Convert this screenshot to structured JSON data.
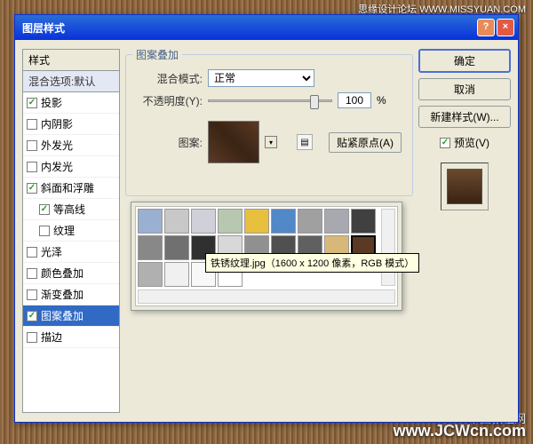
{
  "top_watermark": "思缘设计论坛  WWW.MISSYUAN.COM",
  "bottom_cn": "中国教程网",
  "bottom_url": "www.JCWcn.com",
  "dialog": {
    "title": "图层样式",
    "styles_header": "样式",
    "blend_defaults": "混合选项:默认",
    "items": [
      {
        "label": "投影",
        "checked": true,
        "indent": false
      },
      {
        "label": "内阴影",
        "checked": false,
        "indent": false
      },
      {
        "label": "外发光",
        "checked": false,
        "indent": false
      },
      {
        "label": "内发光",
        "checked": false,
        "indent": false
      },
      {
        "label": "斜面和浮雕",
        "checked": true,
        "indent": false
      },
      {
        "label": "等高线",
        "checked": true,
        "indent": true
      },
      {
        "label": "纹理",
        "checked": false,
        "indent": true
      },
      {
        "label": "光泽",
        "checked": false,
        "indent": false
      },
      {
        "label": "颜色叠加",
        "checked": false,
        "indent": false
      },
      {
        "label": "渐变叠加",
        "checked": false,
        "indent": false
      },
      {
        "label": "图案叠加",
        "checked": true,
        "indent": false,
        "active": true
      },
      {
        "label": "描边",
        "checked": false,
        "indent": false
      }
    ]
  },
  "main": {
    "section_title": "图案叠加",
    "group_title": "图案",
    "blend_mode_label": "混合模式:",
    "blend_mode_value": "正常",
    "opacity_label": "不透明度(Y):",
    "opacity_value": "100",
    "opacity_unit": "%",
    "pattern_label": "图案:",
    "snap_origin": "贴紧原点(A)",
    "tooltip": "铁锈纹理.jpg（1600 x 1200 像素，RGB 模式）"
  },
  "right": {
    "ok": "确定",
    "cancel": "取消",
    "new_style": "新建样式(W)...",
    "preview_label": "预览(V)"
  },
  "swatches": [
    "#9ab0d0",
    "#c8c8c8",
    "#d0d0d8",
    "#b8c8b0",
    "#e8c040",
    "#5088c8",
    "#a0a0a0",
    "#a8a8b0",
    "#404040",
    "#888888",
    "#707070",
    "#303030",
    "#d8d8d8",
    "#909090",
    "#505050",
    "#606060",
    "#d8b878",
    "#5a3a24",
    "#b0b0b0",
    "#f0f0f0",
    "#f8f8f8",
    "#ffffff"
  ],
  "selected_swatch_index": 17
}
